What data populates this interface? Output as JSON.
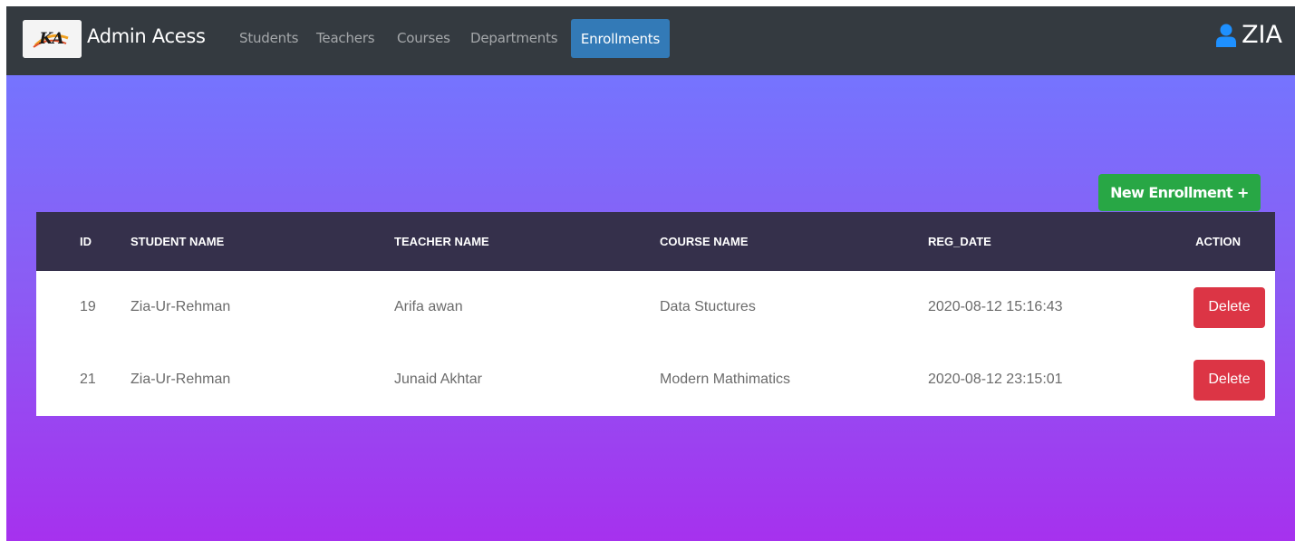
{
  "navbar": {
    "brand": "Admin Acess",
    "logo_text": "KA",
    "links": [
      "Students",
      "Teachers",
      "Courses",
      "Departments"
    ],
    "active_link": "Enrollments",
    "user_name": "ZIA",
    "user_icon": "user-icon"
  },
  "actions": {
    "new_enrollment_label": "New Enrollment +"
  },
  "table": {
    "headers": [
      "ID",
      "STUDENT NAME",
      "TEACHER NAME",
      "COURSE NAME",
      "REG_DATE",
      "ACTION"
    ],
    "rows": [
      {
        "id": "19",
        "student": "Zia-Ur-Rehman",
        "teacher": "Arifa awan",
        "course": "Data Stuctures",
        "reg_date": "2020-08-12 15:16:43",
        "action": "Delete"
      },
      {
        "id": "21",
        "student": "Zia-Ur-Rehman",
        "teacher": "Junaid Akhtar",
        "course": "Modern Mathimatics",
        "reg_date": "2020-08-12 23:15:01",
        "action": "Delete"
      }
    ]
  },
  "colors": {
    "navbar_bg": "#343a40",
    "active_nav_bg": "#337ab7",
    "gradient_top": "#7574fe",
    "gradient_bottom": "#a631ee",
    "table_header_bg": "#35304b",
    "success": "#28a745",
    "danger": "#dc3545",
    "user_icon": "#1e90ff"
  }
}
